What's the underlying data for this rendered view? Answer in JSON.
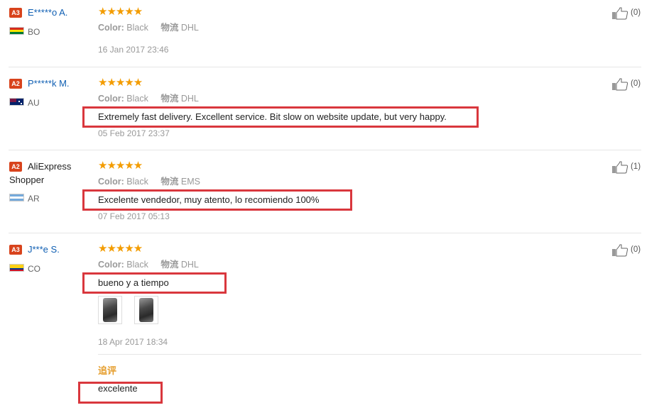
{
  "reviews": [
    {
      "badge": "A3",
      "username": "E*****o A.",
      "country": "BO",
      "stars": "★★★★★",
      "color_label": "Color:",
      "color_value": "Black",
      "ship_label": "物流",
      "ship_value": "DHL",
      "text": "",
      "date": "16 Jan 2017 23:46",
      "likes": "(0)",
      "flag_colors": [
        "#d52b1e",
        "#f9e300",
        "#007934"
      ]
    },
    {
      "badge": "A2",
      "username": "P*****k M.",
      "country": "AU",
      "stars": "★★★★★",
      "color_label": "Color:",
      "color_value": "Black",
      "ship_label": "物流",
      "ship_value": "DHL",
      "text": "Extremely fast delivery. Excellent service. Bit slow on website update, but very happy.",
      "date": "05 Feb 2017 23:37",
      "likes": "(0)"
    },
    {
      "badge": "A2",
      "username_line1": "AliExpress",
      "username_line2": "Shopper",
      "country": "AR",
      "stars": "★★★★★",
      "color_label": "Color:",
      "color_value": "Black",
      "ship_label": "物流",
      "ship_value": "EMS",
      "text": "Excelente vendedor, muy atento, lo recomiendo 100%",
      "date": "07 Feb 2017 05:13",
      "likes": "(1)"
    },
    {
      "badge": "A3",
      "username": "J***e S.",
      "country": "CO",
      "stars": "★★★★★",
      "color_label": "Color:",
      "color_value": "Black",
      "ship_label": "物流",
      "ship_value": "DHL",
      "text": "bueno y a tiempo",
      "date": "18 Apr 2017 18:34",
      "likes": "(0)",
      "append_label": "追评",
      "append_text": "excelente"
    }
  ],
  "colors": {
    "username_link": "#0f5fb3",
    "star": "#f39c00",
    "badge_bg": "#d8431c",
    "highlight_border": "#d9373d",
    "append_label": "#e59d2c"
  },
  "icons": {
    "like": "thumbs-up-icon",
    "star": "star-icon"
  }
}
